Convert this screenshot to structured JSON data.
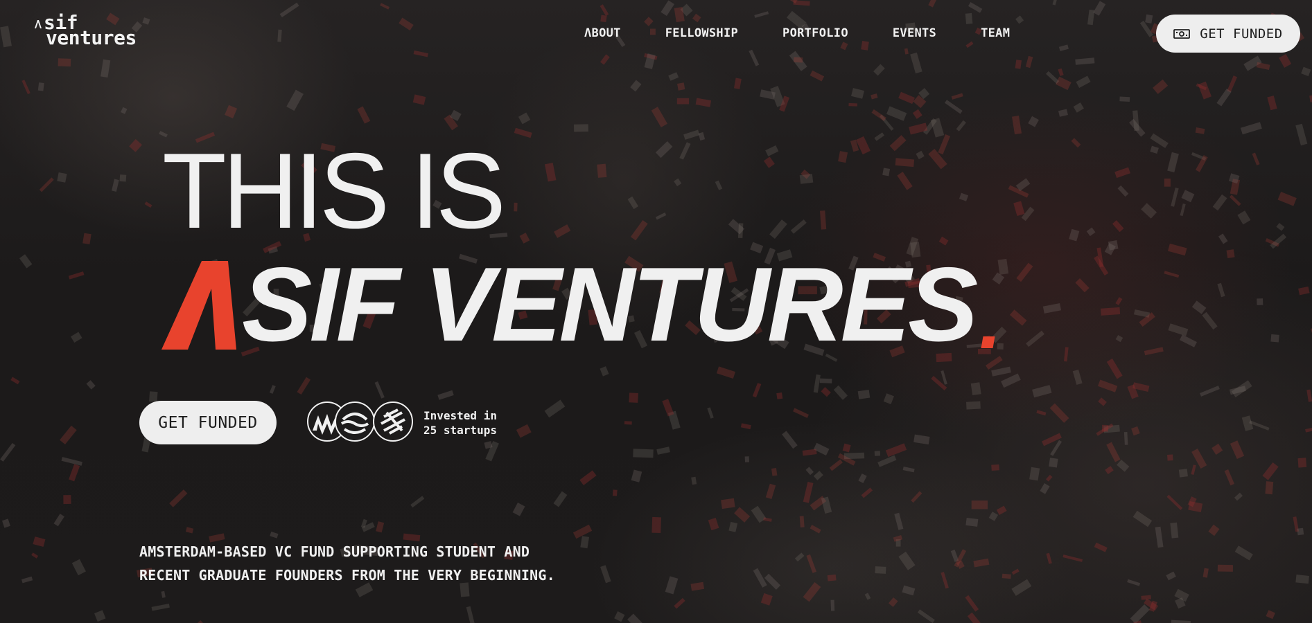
{
  "brand": {
    "logo_line1": "sif",
    "logo_line2": "ventures",
    "accent_color": "#e8432d"
  },
  "nav": {
    "items": [
      {
        "label": "ΛBOUT"
      },
      {
        "label": "FELLOWSHIP"
      },
      {
        "label": "PORTFOLIO"
      },
      {
        "label": "EVENTS"
      },
      {
        "label": "TEAM"
      }
    ],
    "cta_label": "GET FUNDED",
    "cta_icon": "banknote-icon"
  },
  "hero": {
    "line1": "THIS IS",
    "line2": "SIF VENTURES",
    "cta_label": "GET FUNDED",
    "portfolio_logos": [
      "portfolio-logo-1",
      "portfolio-logo-2",
      "portfolio-logo-3"
    ],
    "invested_line1": "Invested in",
    "invested_line2": "25 startups"
  },
  "tagline": {
    "line1": "AMSTERDAM-BASED VC FUND SUPPORTING STUDENT AND",
    "line2": "RECENT GRADUATE FOUNDERS FROM THE VERY BEGINNING."
  }
}
